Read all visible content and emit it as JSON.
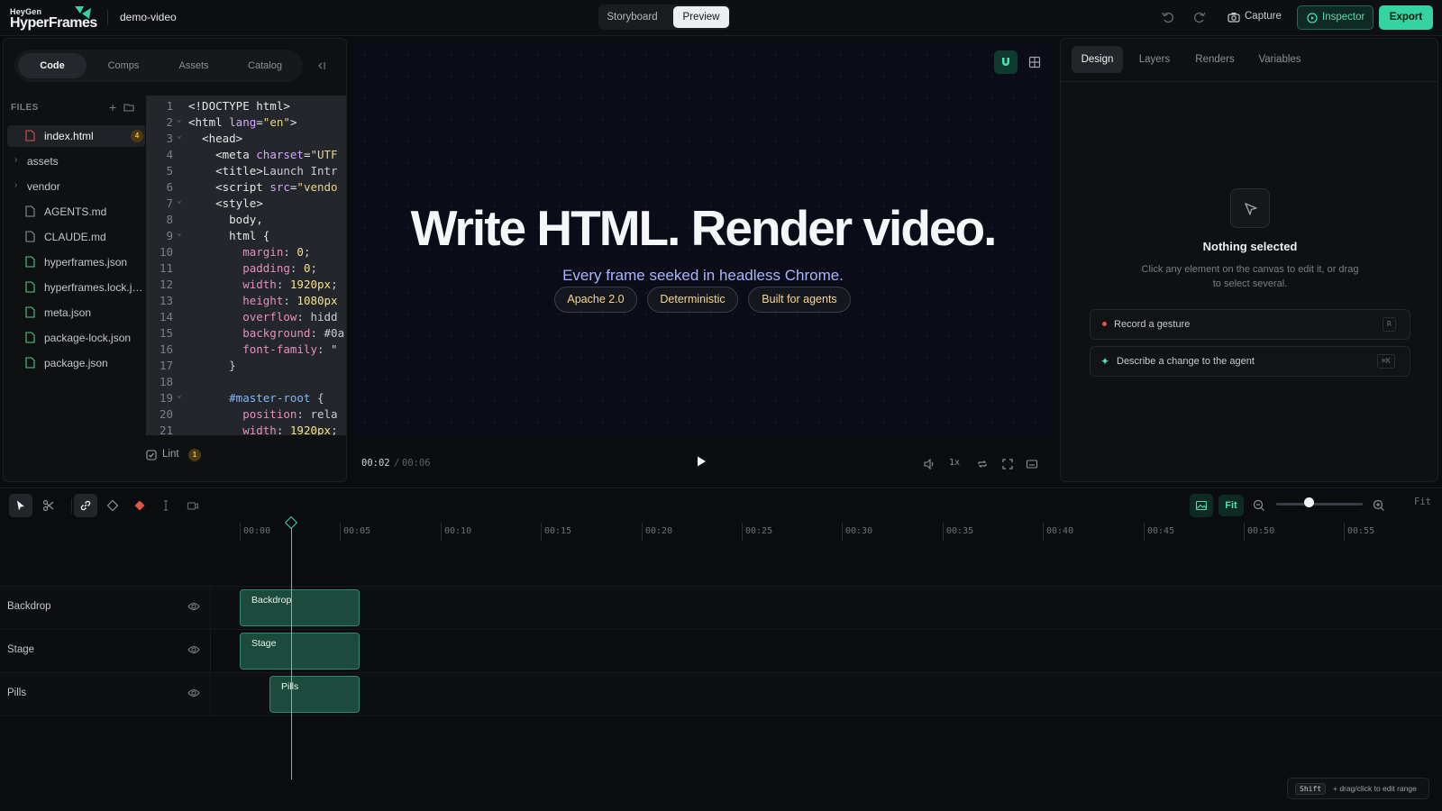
{
  "topbar": {
    "logo_small": "HeyGen",
    "logo_big": "HyperFrames",
    "project_name": "demo-video",
    "modes": [
      "Storyboard",
      "Preview"
    ],
    "active_mode": "Preview",
    "capture_label": "Capture",
    "inspector_label": "Inspector",
    "export_label": "Export",
    "brand_color": "#34d3a0"
  },
  "left": {
    "tabs": [
      "Code",
      "Comps",
      "Assets",
      "Catalog"
    ],
    "active_tab": "Code",
    "files_header": "FILES",
    "files": [
      {
        "name": "index.html",
        "badge": "4",
        "type": "html"
      },
      {
        "name": "assets",
        "type": "folder"
      },
      {
        "name": "vendor",
        "type": "folder"
      },
      {
        "name": "AGENTS.md",
        "type": "md"
      },
      {
        "name": "CLAUDE.md",
        "type": "md"
      },
      {
        "name": "hyperframes.json",
        "type": "json"
      },
      {
        "name": "hyperframes.lock.json",
        "type": "json"
      },
      {
        "name": "meta.json",
        "type": "json"
      },
      {
        "name": "package-lock.json",
        "type": "json"
      },
      {
        "name": "package.json",
        "type": "json"
      }
    ],
    "code_lines": [
      [
        [
          "tk-tag",
          "<!DOCTYPE html>"
        ]
      ],
      [
        [
          "tk-tag",
          "<html "
        ],
        [
          "tk-attr",
          "lang"
        ],
        [
          "tk-tag",
          "="
        ],
        [
          "tk-str",
          "\"en\""
        ],
        [
          "tk-tag",
          ">"
        ]
      ],
      [
        [
          "tk-tag",
          "  <head>"
        ]
      ],
      [
        [
          "tk-tag",
          "    <meta "
        ],
        [
          "tk-attr",
          "charset"
        ],
        [
          "tk-tag",
          "="
        ],
        [
          "tk-str",
          "\"UTF"
        ]
      ],
      [
        [
          "tk-tag",
          "    <title>"
        ],
        [
          "tk-plain",
          "Launch Intr"
        ]
      ],
      [
        [
          "tk-tag",
          "    <script "
        ],
        [
          "tk-attr",
          "src"
        ],
        [
          "tk-tag",
          "="
        ],
        [
          "tk-str",
          "\"vendo"
        ]
      ],
      [
        [
          "tk-tag",
          "    <style>"
        ]
      ],
      [
        [
          "tk-tag",
          "      body,"
        ]
      ],
      [
        [
          "tk-tag",
          "      html {"
        ]
      ],
      [
        [
          "tk-prop",
          "        margin"
        ],
        [
          "tk-plain",
          ": "
        ],
        [
          "tk-num",
          "0"
        ],
        [
          "tk-plain",
          ";"
        ]
      ],
      [
        [
          "tk-prop",
          "        padding"
        ],
        [
          "tk-plain",
          ": "
        ],
        [
          "tk-num",
          "0"
        ],
        [
          "tk-plain",
          ";"
        ]
      ],
      [
        [
          "tk-prop",
          "        width"
        ],
        [
          "tk-plain",
          ": "
        ],
        [
          "tk-num",
          "1920px"
        ],
        [
          "tk-plain",
          ";"
        ]
      ],
      [
        [
          "tk-prop",
          "        height"
        ],
        [
          "tk-plain",
          ": "
        ],
        [
          "tk-num",
          "1080px"
        ]
      ],
      [
        [
          "tk-prop",
          "        overflow"
        ],
        [
          "tk-plain",
          ": hidd"
        ]
      ],
      [
        [
          "tk-prop",
          "        background"
        ],
        [
          "tk-plain",
          ": #0a"
        ]
      ],
      [
        [
          "tk-prop",
          "        font-family"
        ],
        [
          "tk-plain",
          ": \""
        ]
      ],
      [
        [
          "tk-plain",
          "      }"
        ]
      ],
      [
        [
          "tk-plain",
          ""
        ]
      ],
      [
        [
          "tk-sel",
          "      #master-root"
        ],
        [
          "tk-plain",
          " {"
        ]
      ],
      [
        [
          "tk-prop",
          "        position"
        ],
        [
          "tk-plain",
          ": rela"
        ]
      ],
      [
        [
          "tk-prop",
          "        width"
        ],
        [
          "tk-plain",
          ": "
        ],
        [
          "tk-num",
          "1920px"
        ],
        [
          "tk-plain",
          ";"
        ]
      ]
    ],
    "fold_lines": [
      2,
      3,
      7,
      9,
      19
    ],
    "lint_label": "Lint",
    "lint_count": "1"
  },
  "preview": {
    "headline": "Write HTML. Render video.",
    "subheadline": "Every frame seeked in headless Chrome.",
    "pills": [
      "Apache 2.0",
      "Deterministic",
      "Built for agents"
    ],
    "time_current": "00:02",
    "time_separator": "/",
    "time_total": "00:06",
    "speed": "1x"
  },
  "right": {
    "tabs": [
      "Design",
      "Layers",
      "Renders",
      "Variables"
    ],
    "active_tab": "Design",
    "empty_title": "Nothing selected",
    "empty_desc": "Click any element on the canvas to edit it, or drag to select several.",
    "actions": [
      {
        "label": "Record a gesture",
        "key": "R"
      },
      {
        "label": "Describe a change to the agent",
        "key": "⌘K"
      }
    ]
  },
  "timeline": {
    "fit_label": "Fit",
    "fit_mono": "Fit",
    "ruler_labels": [
      "00:00",
      "00:05",
      "00:10",
      "00:15",
      "00:20",
      "00:25",
      "00:30",
      "00:35",
      "00:40",
      "00:45",
      "00:50",
      "00:55"
    ],
    "tracks": [
      {
        "name": "Backdrop",
        "clip": "Backdrop"
      },
      {
        "name": "Stage",
        "clip": "Stage"
      },
      {
        "name": "Pills",
        "clip": "Pills"
      }
    ],
    "hint_key": "Shift",
    "hint_text": "+ drag/click to edit range"
  }
}
